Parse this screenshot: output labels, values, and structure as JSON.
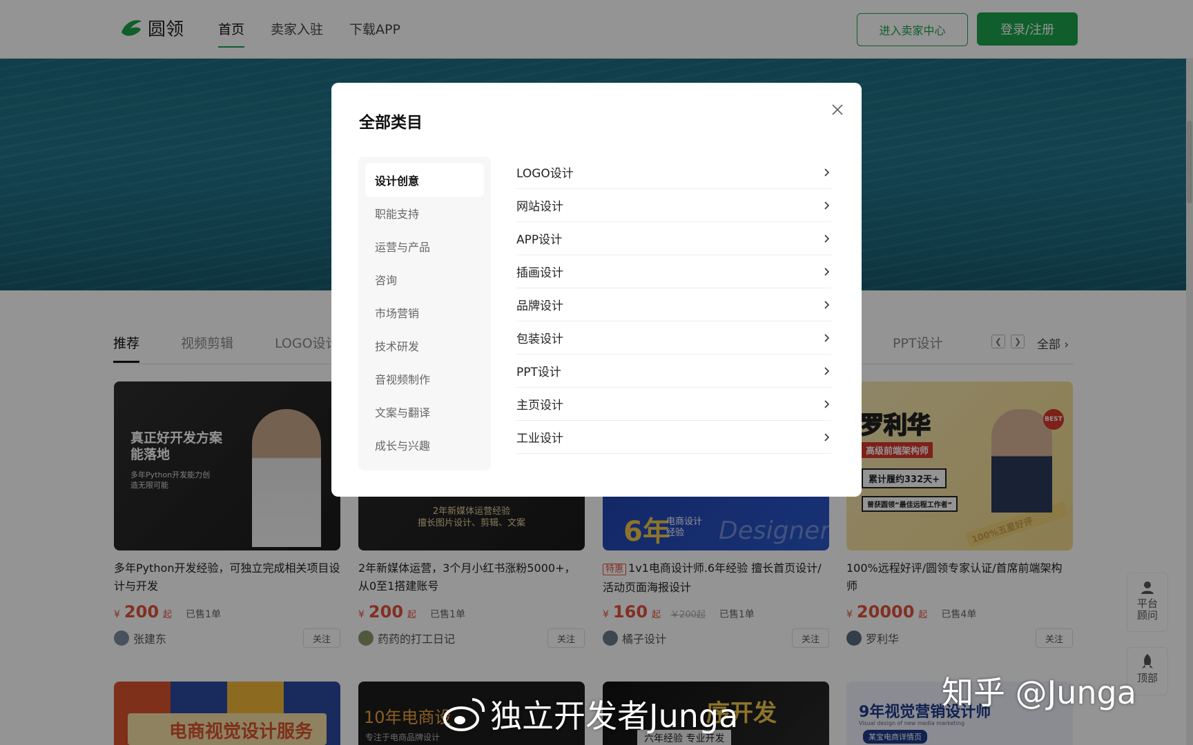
{
  "header": {
    "logo_text": "圆领",
    "nav": [
      "首页",
      "卖家入驻",
      "下载APP"
    ],
    "seller_center": "进入卖家中心",
    "login": "登录/注册"
  },
  "tabs": {
    "items": [
      "推荐",
      "视频剪辑",
      "LOGO设计",
      "PPT设计"
    ],
    "all": "全部"
  },
  "cards": [
    {
      "img_title": "真正好开发方案\n能落地",
      "img_sub": "多年Python开发能力创\n造无限可能",
      "title": "多年Python开发经验，可独立完成相关项目设计与开发",
      "price": "200",
      "qi": "起",
      "sold": "已售1单",
      "seller": "张建东",
      "follow": "关注",
      "yen": "¥"
    },
    {
      "img_sub": "2年新媒体运营经验\n擅长图片设计、剪辑、文案",
      "title": "2年新媒体运营，3个月小红书涨粉5000+，从0至1搭建账号",
      "price": "200",
      "qi": "起",
      "sold": "已售1单",
      "seller": "药药的打工日记",
      "follow": "关注",
      "yen": "¥"
    },
    {
      "img_big": "6年",
      "img_sub": "电商设计\n经验",
      "img_brand": "Designer",
      "tag": "特惠",
      "title": "1v1电商设计师.6年经验 擅长首页设计/活动页面海报设计",
      "price": "160",
      "qi": "起",
      "old": "￥200起",
      "sold": "已售1单",
      "seller": "橘子设计",
      "follow": "关注",
      "yen": "¥"
    },
    {
      "img_name": "罗利华",
      "img_role": "高级前端架构师",
      "img_line1": "累计履约332天+",
      "img_line2": "曾获圆领“最佳远程工作者”",
      "img_band": "100%五星好评",
      "img_badge": "BEST",
      "title": "100%远程好评/圆领专家认证/首席前端架构师",
      "price": "20000",
      "qi": "起",
      "sold": "已售4单",
      "seller": "罗利华",
      "follow": "关注",
      "yen": "¥"
    }
  ],
  "bottom_cards": [
    {
      "text": "电商视觉设计服务"
    },
    {
      "text": "10年电商设",
      "sub": "专注于电商品牌设计"
    },
    {
      "text": "序开发",
      "sub": "六年经验 专业开发"
    },
    {
      "text": "9年视觉营销设计师",
      "sub": "Visual design of new media marketing",
      "badge": "某宝电商详情页"
    }
  ],
  "side": {
    "advisor": "平台\n顾问",
    "top": "顶部"
  },
  "modal": {
    "title": "全部类目",
    "categories": [
      "设计创意",
      "职能支持",
      "运营与产品",
      "咨询",
      "市场营销",
      "技术研发",
      "音视频制作",
      "文案与翻译",
      "成长与兴趣"
    ],
    "subcategories": [
      "LOGO设计",
      "网站设计",
      "APP设计",
      "插画设计",
      "品牌设计",
      "包装设计",
      "PPT设计",
      "主页设计",
      "工业设计"
    ]
  },
  "watermark": {
    "zhihu": "知乎 @Junga",
    "weibo": "独立开发者Junga"
  },
  "colors": {
    "brand": "#1aa34a",
    "price": "#e0523c"
  }
}
